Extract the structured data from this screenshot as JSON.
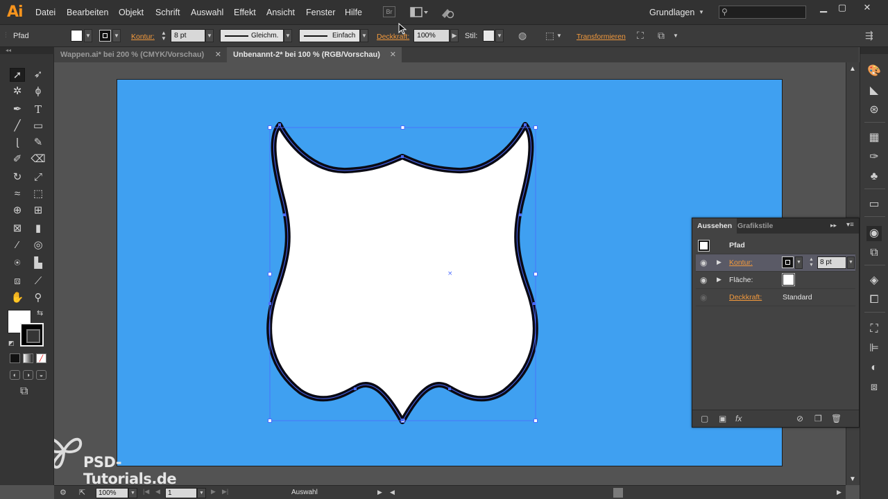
{
  "app": {
    "logo": "Ai"
  },
  "menu": [
    "Datei",
    "Bearbeiten",
    "Objekt",
    "Schrift",
    "Auswahl",
    "Effekt",
    "Ansicht",
    "Fenster",
    "Hilfe"
  ],
  "menubar_icons": {
    "bridge": "Br"
  },
  "workspace": "Grundlagen",
  "control": {
    "selection_label": "Pfad",
    "stroke_link": "Kontur:",
    "stroke_weight": "8 pt",
    "profile": "Gleichm.",
    "brush": "Einfach",
    "opacity_link": "Deckkraft:",
    "opacity_value": "100%",
    "style_label": "Stil:",
    "transform_link": "Transformieren"
  },
  "tabs": [
    {
      "label": "Wappen.ai* bei 200 % (CMYK/Vorschau)",
      "active": false
    },
    {
      "label": "Unbenannt-2* bei 100 % (RGB/Vorschau)",
      "active": true
    }
  ],
  "colors": {
    "artboard": "#3fa0f1",
    "accent_link": "#f39a3d",
    "selection": "#4b6bff",
    "shape_fill": "#ffffff",
    "shape_stroke": "#0a0a14"
  },
  "appearance_panel": {
    "tabs": [
      "Aussehen",
      "Grafikstile"
    ],
    "title": "Pfad",
    "rows": [
      {
        "label": "Konturfarbe",
        "display": "Kontur:",
        "value": "8 pt"
      },
      {
        "display": "Fläche:"
      },
      {
        "display": "Deckkraft:",
        "value": "Standard"
      }
    ]
  },
  "status": {
    "zoom": "100%",
    "page": "1",
    "tool": "Auswahl"
  },
  "watermark": {
    "text": "PSD-Tutorials.de"
  }
}
